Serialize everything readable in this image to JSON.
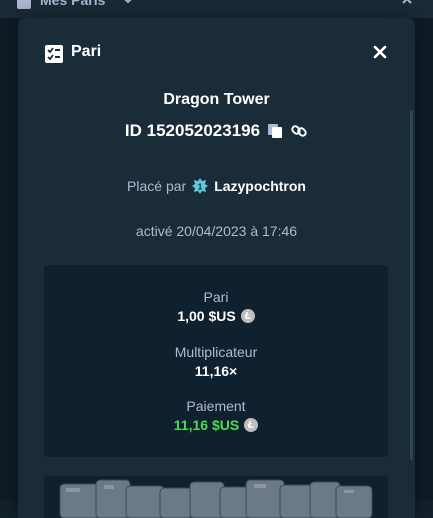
{
  "background": {
    "title": "Mes Paris",
    "icons": {
      "list": "bet-list-icon",
      "chevron": "chevron-down-icon",
      "close": "close-icon"
    }
  },
  "modal": {
    "title": "Pari",
    "title_icon": "bet-slip-icon",
    "close_icon": "close-icon",
    "game_name": "Dragon Tower",
    "bet_id": "ID 152052023196",
    "copy_icon": "copy-icon",
    "link_icon": "link-icon",
    "placed_by_label": "Placé par",
    "vip_icon": "vip-rank-icon",
    "username": "Lazypochtron",
    "activated": "activé 20/04/2023 à 17:46",
    "stats": {
      "bet_label": "Pari",
      "bet_value": "1,00 $US",
      "multiplier_label": "Multiplicateur",
      "multiplier_value": "11,16×",
      "payout_label": "Paiement",
      "payout_value": "11,16 $US",
      "currency_icon": "litecoin-icon"
    }
  },
  "colors": {
    "page_bg": "#13222c",
    "modal_bg": "#1a2c38",
    "box_bg": "#0f212e",
    "text_muted": "#b1bad3",
    "text_white": "#ffffff",
    "win_green": "#4ade52",
    "vip_accent": "#5ec9d8"
  }
}
